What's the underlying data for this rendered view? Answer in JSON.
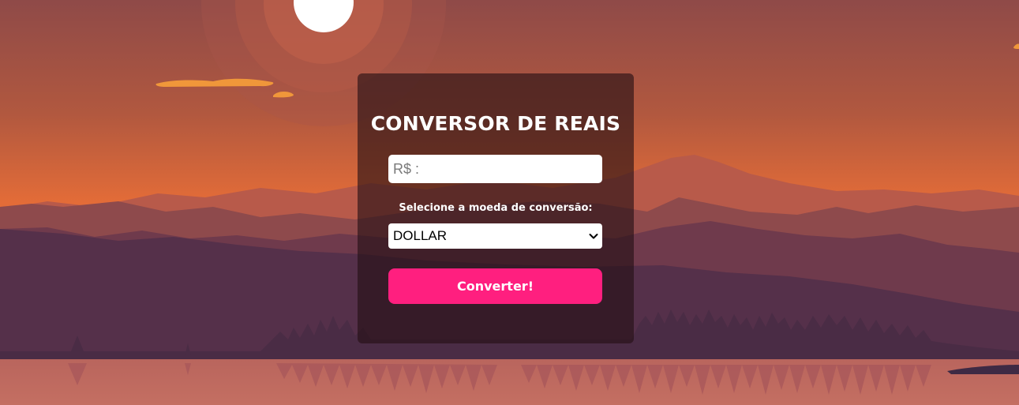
{
  "converter": {
    "title": "CONVERSOR DE REAIS",
    "amount_placeholder": "R$ :",
    "amount_value": "",
    "select_label": "Selecione a moeda de conversão:",
    "selected_currency": "DOLLAR",
    "button_label": "Converter!"
  },
  "icons": {
    "select_arrow": "chevron-down-icon"
  },
  "colors": {
    "button": "#ff1f7f",
    "card_background": "rgba(35, 15, 20, 0.62)",
    "sky_top": "#8e4a48",
    "sky_bottom": "#e0733a"
  }
}
